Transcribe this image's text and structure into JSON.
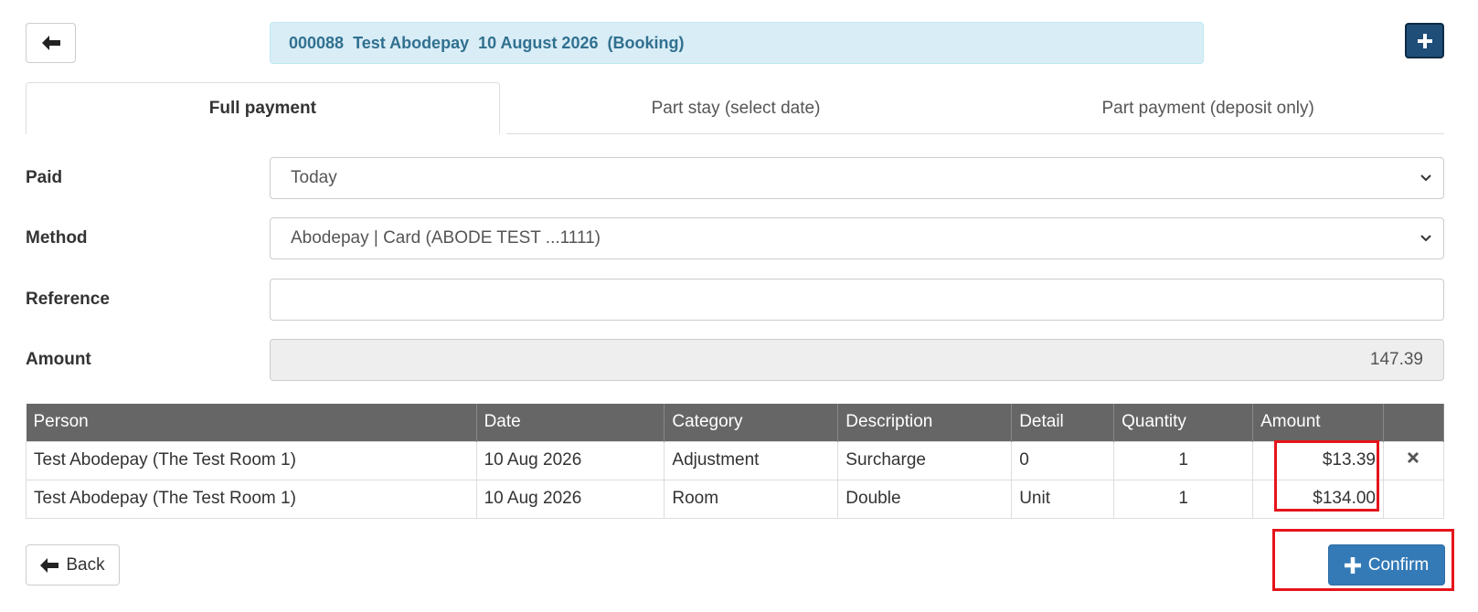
{
  "header": {
    "booking_title": "000088  Test Abodepay  10 August 2026  (Booking)"
  },
  "tabs": [
    {
      "label": "Full payment",
      "active": true
    },
    {
      "label": "Part stay (select date)",
      "active": false
    },
    {
      "label": "Part payment (deposit only)",
      "active": false
    }
  ],
  "form": {
    "paid_label": "Paid",
    "paid_value": "Today",
    "method_label": "Method",
    "method_value": "Abodepay | Card (ABODE TEST ...1111)",
    "reference_label": "Reference",
    "reference_value": "",
    "amount_label": "Amount",
    "amount_value": "147.39"
  },
  "table": {
    "columns": [
      "Person",
      "Date",
      "Category",
      "Description",
      "Detail",
      "Quantity",
      "Amount"
    ],
    "rows": [
      {
        "person": "Test Abodepay (The Test Room 1)",
        "date": "10 Aug 2026",
        "category": "Adjustment",
        "description": "Surcharge",
        "detail": "0",
        "quantity": "1",
        "amount": "$13.39",
        "removable": true
      },
      {
        "person": "Test Abodepay (The Test Room 1)",
        "date": "10 Aug 2026",
        "category": "Room",
        "description": "Double",
        "detail": "Unit",
        "quantity": "1",
        "amount": "$134.00",
        "removable": false
      }
    ]
  },
  "actions": {
    "back_label": "Back",
    "confirm_label": "Confirm"
  },
  "colors": {
    "banner_bg": "#d9edf7",
    "banner_text": "#31708f",
    "table_header": "#666666",
    "confirm": "#337ab7",
    "highlight": "#e5141a"
  }
}
